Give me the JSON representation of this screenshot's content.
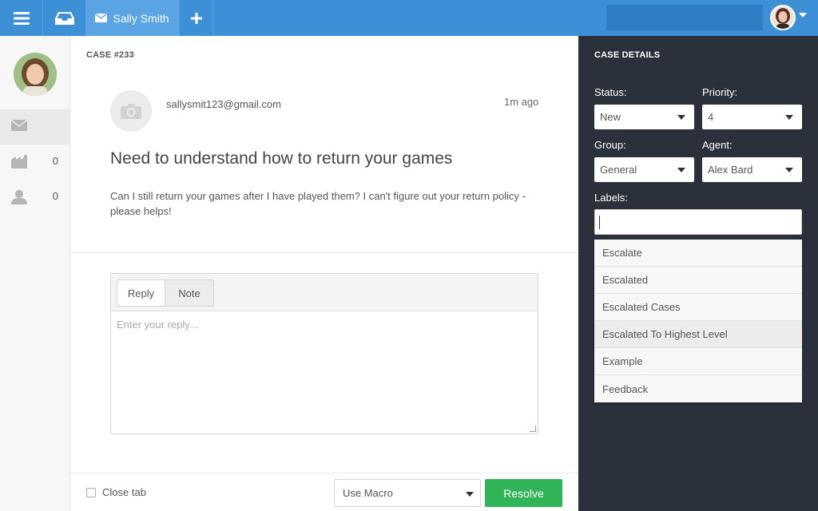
{
  "topbar": {
    "tab_label": "Sally Smith",
    "search_placeholder": "",
    "accent": "#3d8fd6"
  },
  "sidebar": {
    "items": [
      {
        "icon": "envelope-icon",
        "count": ""
      },
      {
        "icon": "building-icon",
        "count": "0"
      },
      {
        "icon": "person-icon",
        "count": "0"
      }
    ]
  },
  "case": {
    "number": "CASE #233",
    "email": "sallysmit123@gmail.com",
    "time": "1m ago",
    "subject": "Need to understand how to return your games",
    "body": "Can I still return your games after I have played them? I can't figure out your return policy - please helps!"
  },
  "reply": {
    "tabs": [
      "Reply",
      "Note"
    ],
    "placeholder": "Enter your reply..."
  },
  "footer": {
    "close_tab_label": "Close tab",
    "macro_label": "Use Macro",
    "resolve_label": "Resolve",
    "resolve_color": "#30b457"
  },
  "details": {
    "title": "CASE DETAILS",
    "status_label": "Status:",
    "status_value": "New",
    "priority_label": "Priority:",
    "priority_value": "4",
    "group_label": "Group:",
    "group_value": "General",
    "agent_label": "Agent:",
    "agent_value": "Alex Bard",
    "labels_label": "Labels:",
    "label_options": [
      "Escalate",
      "Escalated",
      "Escalated Cases",
      "Escalated To Highest Level",
      "Example",
      "Feedback"
    ],
    "panel_color": "#2a313b"
  }
}
